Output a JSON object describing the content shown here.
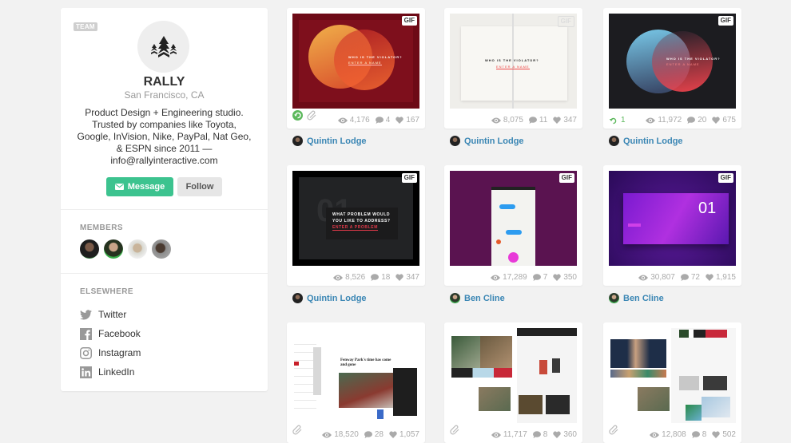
{
  "profile": {
    "badge": "TEAM",
    "name": "RALLY",
    "location": "San Francisco, CA",
    "bio": "Product Design + Engineering studio. Trusted by companies like Toyota, Google, InVision, Nike, PayPal, Nat Geo, & ESPN since 2011 — info@rallyinteractive.com",
    "message_label": "Message",
    "follow_label": "Follow",
    "members_title": "MEMBERS",
    "members": [
      {
        "name": "member-1"
      },
      {
        "name": "member-2"
      },
      {
        "name": "member-3"
      },
      {
        "name": "member-4"
      }
    ],
    "elsewhere_title": "ELSEWHERE",
    "links": [
      {
        "label": "Twitter",
        "icon": "twitter-icon"
      },
      {
        "label": "Facebook",
        "icon": "facebook-icon"
      },
      {
        "label": "Instagram",
        "icon": "instagram-icon"
      },
      {
        "label": "LinkedIn",
        "icon": "linkedin-icon"
      }
    ]
  },
  "shots": [
    {
      "gif": "GIF",
      "views": "4,176",
      "comments": "4",
      "likes": "167",
      "author": "Quintin Lodge",
      "rebound": true,
      "attachment": true,
      "rebound_count": ""
    },
    {
      "gif": "GIF",
      "views": "8,075",
      "comments": "11",
      "likes": "347",
      "author": "Quintin Lodge"
    },
    {
      "gif": "GIF",
      "views": "11,972",
      "comments": "20",
      "likes": "675",
      "author": "Quintin Lodge",
      "rebound_count": "1"
    },
    {
      "gif": "GIF",
      "views": "8,526",
      "comments": "18",
      "likes": "347",
      "author": "Quintin Lodge"
    },
    {
      "gif": "GIF",
      "views": "17,289",
      "comments": "7",
      "likes": "350",
      "author": "Ben Cline"
    },
    {
      "gif": "GIF",
      "views": "30,807",
      "comments": "72",
      "likes": "1,915",
      "author": "Ben Cline"
    },
    {
      "views": "18,520",
      "comments": "28",
      "likes": "1,057",
      "attachment": true
    },
    {
      "views": "11,717",
      "comments": "8",
      "likes": "360",
      "attachment": true
    },
    {
      "views": "12,808",
      "comments": "8",
      "likes": "502",
      "attachment": true
    }
  ],
  "thumb_text": {
    "violator_q": "WHO IS THE VIOLATOR?",
    "violator_cta": "ENTER A NAME",
    "problem_q1": "WHAT PROBLEM WOULD",
    "problem_q2": "YOU LIKE TO ADDRESS?",
    "problem_cta": "ENTER A PROBLEM",
    "big_number": "01",
    "ghost_number": "01",
    "news_headline": "Fenway Park's time has come and gone"
  },
  "colors": {
    "accent_green": "#3cc38f",
    "link_blue": "#3a86b4",
    "rebound_green": "#5cb85c"
  }
}
